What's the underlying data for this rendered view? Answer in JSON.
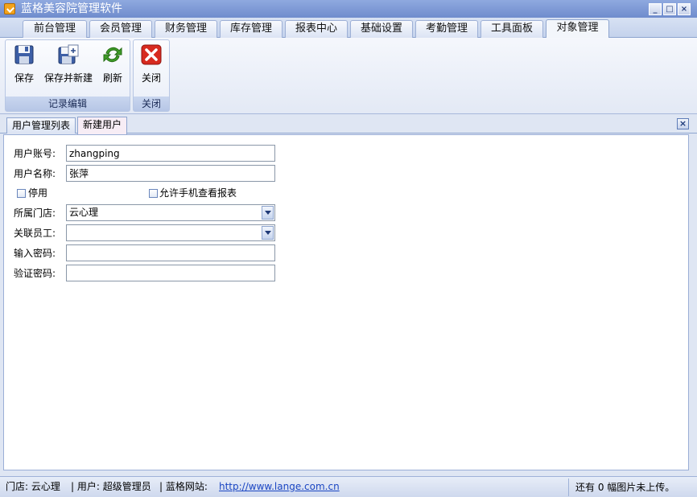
{
  "window": {
    "title": "蓝格美容院管理软件",
    "controls": {
      "minimize": "_",
      "maximize": "□",
      "close": "×"
    }
  },
  "main_tabs": [
    {
      "label": "前台管理"
    },
    {
      "label": "会员管理"
    },
    {
      "label": "财务管理"
    },
    {
      "label": "库存管理"
    },
    {
      "label": "报表中心"
    },
    {
      "label": "基础设置"
    },
    {
      "label": "考勤管理"
    },
    {
      "label": "工具面板"
    },
    {
      "label": "对象管理",
      "active": true
    }
  ],
  "ribbon": {
    "groups": [
      {
        "caption": "记录编辑",
        "buttons": [
          {
            "label": "保存",
            "icon": "save-icon"
          },
          {
            "label": "保存并新建",
            "icon": "save-new-icon"
          },
          {
            "label": "刷新",
            "icon": "refresh-icon"
          }
        ]
      },
      {
        "caption": "关闭",
        "buttons": [
          {
            "label": "关闭",
            "icon": "close-red-icon"
          }
        ]
      }
    ]
  },
  "doc_tabs": [
    {
      "label": "用户管理列表"
    },
    {
      "label": "新建用户",
      "active": true
    }
  ],
  "form": {
    "account": {
      "label": "用户账号:",
      "value": "zhangping"
    },
    "name": {
      "label": "用户名称:",
      "value": "张萍"
    },
    "disabled": {
      "label": "停用",
      "checked": false
    },
    "allow_mobile": {
      "label": "允许手机查看报表",
      "checked": false
    },
    "store": {
      "label": "所属门店:",
      "value": "云心理"
    },
    "employee": {
      "label": "关联员工:",
      "value": ""
    },
    "password": {
      "label": "输入密码:",
      "value": ""
    },
    "confirm_password": {
      "label": "验证密码:",
      "value": ""
    }
  },
  "statusbar": {
    "store": "门店: 云心理",
    "user": "| 用户: 超级管理员",
    "site_label": "| 蓝格网站:",
    "site_url": "http://www.lange.com.cn",
    "upload_status": "还有 0 幅图片未上传。"
  },
  "colors": {
    "title_bar": "#7b97d6",
    "ribbon_bg": "#eef2fa",
    "active_doc_tab": "#f7edf5",
    "link": "#1b46c3"
  }
}
